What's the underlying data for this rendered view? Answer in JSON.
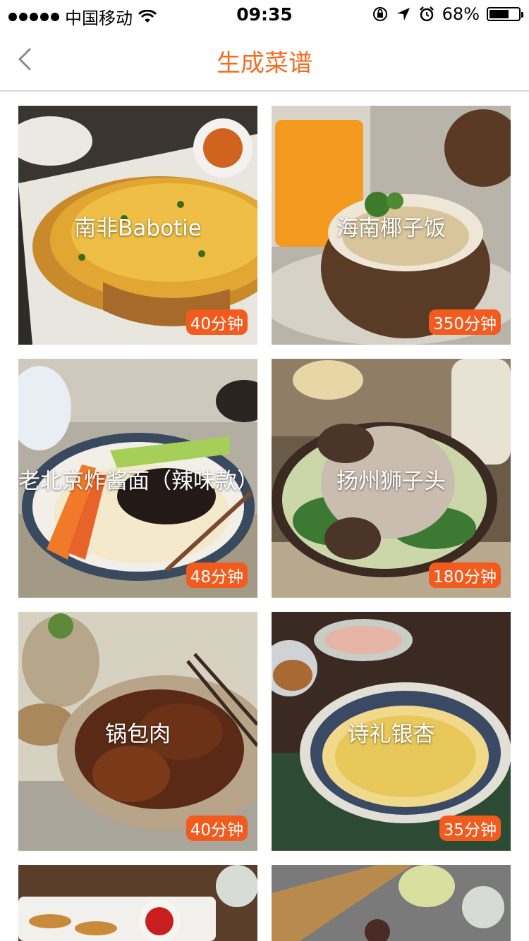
{
  "status": {
    "carrier": "中国移动",
    "time": "09:35",
    "battery_percent": "68%",
    "battery_level": 0.68
  },
  "nav": {
    "title": "生成菜谱",
    "accent_color": "#f36c21"
  },
  "recipes": [
    {
      "name": "南非Babotie",
      "time": "40分钟"
    },
    {
      "name": "海南椰子饭",
      "time": "350分钟"
    },
    {
      "name": "老北京炸酱面（辣味款）",
      "time": "48分钟"
    },
    {
      "name": "扬州狮子头",
      "time": "180分钟"
    },
    {
      "name": "锅包肉",
      "time": "40分钟"
    },
    {
      "name": "诗礼银杏",
      "time": "35分钟"
    }
  ],
  "badge_color": "#f25a1e"
}
